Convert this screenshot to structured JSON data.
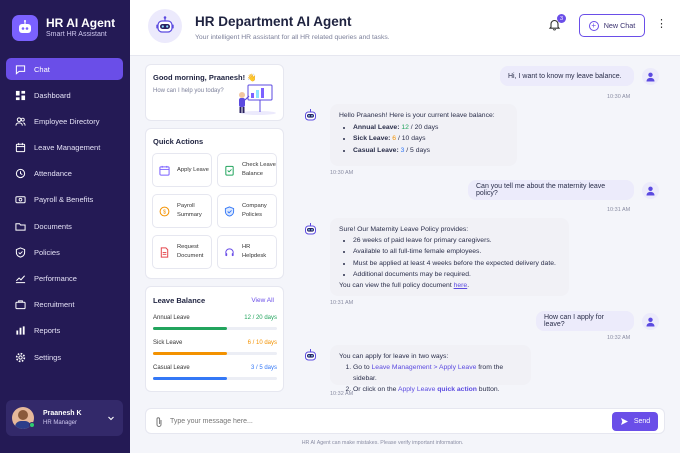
{
  "sidebar": {
    "brand_title": "HR AI Agent",
    "brand_subtitle": "Smart HR Assistant",
    "items": [
      {
        "label": "Chat",
        "icon": "chat-icon",
        "active": true
      },
      {
        "label": "Dashboard",
        "icon": "dashboard-icon"
      },
      {
        "label": "Employee Directory",
        "icon": "users-icon"
      },
      {
        "label": "Leave Management",
        "icon": "calendar-icon"
      },
      {
        "label": "Attendance",
        "icon": "clock-icon"
      },
      {
        "label": "Payroll & Benefits",
        "icon": "money-icon"
      },
      {
        "label": "Documents",
        "icon": "folder-icon"
      },
      {
        "label": "Policies",
        "icon": "shield-icon"
      },
      {
        "label": "Performance",
        "icon": "chart-line-icon"
      },
      {
        "label": "Recruitment",
        "icon": "briefcase-icon"
      },
      {
        "label": "Reports",
        "icon": "bar-chart-icon"
      },
      {
        "label": "Settings",
        "icon": "gear-icon"
      }
    ],
    "profile": {
      "name": "Praanesh K",
      "role": "HR Manager"
    }
  },
  "header": {
    "title": "HR Department AI Agent",
    "subtitle": "Your intelligent HR assistant for all HR related queries and tasks.",
    "notification_count": "3",
    "new_chat_label": "New Chat"
  },
  "greeting": {
    "title": "Good morning, Praanesh! 👋",
    "subtitle": "How can I help you today?"
  },
  "quick_actions": {
    "title": "Quick Actions",
    "items": [
      {
        "line1": "Apply Leave",
        "line2": "",
        "icon": "calendar-icon",
        "color": "#7b61ff"
      },
      {
        "line1": "Check Leave",
        "line2": "Balance",
        "icon": "clipboard-icon",
        "color": "#22a45d"
      },
      {
        "line1": "Payroll",
        "line2": "Summary",
        "icon": "coin-icon",
        "color": "#f39200"
      },
      {
        "line1": "Company",
        "line2": "Policies",
        "icon": "shield-icon",
        "color": "#3478f6"
      },
      {
        "line1": "Request",
        "line2": "Document",
        "icon": "document-icon",
        "color": "#e5484d"
      },
      {
        "line1": "HR Helpdesk",
        "line2": "",
        "icon": "headset-icon",
        "color": "#6a4ee8"
      }
    ]
  },
  "leave_balance": {
    "title": "Leave Balance",
    "view_all": "View All",
    "rows": [
      {
        "name": "Annual Leave",
        "value": "12 / 20 days",
        "fraction": 0.6,
        "color": "#22a45d"
      },
      {
        "name": "Sick Leave",
        "value": "6 / 10 days",
        "fraction": 0.6,
        "color": "#f39200"
      },
      {
        "name": "Casual Leave",
        "value": "3 / 5 days",
        "fraction": 0.6,
        "color": "#3478f6"
      }
    ]
  },
  "messages": {
    "m1": {
      "text": "Hi, I want to know my leave balance.",
      "time": "10:30 AM"
    },
    "m2": {
      "intro": "Hello Praanesh! Here is your current leave balance:",
      "annual_label": "Annual Leave:",
      "annual_val": "12",
      "annual_total": " / 20 days",
      "sick_label": "Sick Leave:",
      "sick_val": "6",
      "sick_total": " / 10 days",
      "casual_label": "Casual Leave:",
      "casual_val": "3",
      "casual_total": " / 5 days",
      "time": "10:30 AM"
    },
    "m3": {
      "text": "Can you tell me about the maternity leave policy?",
      "time": "10:31 AM"
    },
    "m4": {
      "intro": "Sure! Our Maternity Leave Policy provides:",
      "b1": "26 weeks of paid leave for primary caregivers.",
      "b2": "Available to all full-time female employees.",
      "b3": "Must be applied at least 4 weeks before the expected delivery date.",
      "b4": "Additional documents may be required.",
      "outro_pre": "You can view the full policy document ",
      "outro_link": "here",
      "outro_post": ".",
      "time": "10:31 AM"
    },
    "m5": {
      "text": "How can I apply for leave?",
      "time": "10:32 AM"
    },
    "m6": {
      "intro": "You can apply for leave in two ways:",
      "s1_pre": "Go to ",
      "s1_link": "Leave Management > Apply Leave",
      "s1_post": " from the sidebar.",
      "s2_pre": "Or click on the ",
      "s2_link": "Apply Leave",
      "s2_mid": " quick action",
      "s2_post": " button.",
      "time": "10:32 AM"
    }
  },
  "composer": {
    "placeholder": "Type your message here...",
    "send_label": "Send"
  },
  "disclaimer": "HR AI Agent can make mistakes. Please verify important information.",
  "colors": {
    "sidebar_bg": "#241a55",
    "accent": "#6a4ee8",
    "green": "#22a45d",
    "orange": "#f39200",
    "blue": "#3478f6"
  }
}
